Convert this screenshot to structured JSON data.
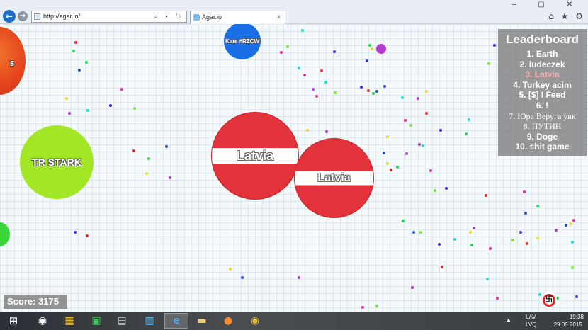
{
  "browser": {
    "back_icon": "back-arrow-icon",
    "forward_icon": "forward-arrow-icon",
    "url": "http://agar.io/",
    "address_tools": "⌕ ▾ ↻",
    "tab_title": "Agar.io",
    "tab_close": "×",
    "window_controls": "– ▢ ✕",
    "toolbar_icons": "⌂ ★ ⚙"
  },
  "game": {
    "cells": [
      {
        "name": "Latvia"
      },
      {
        "name": "Latvia"
      },
      {
        "name": "TR STARK"
      },
      {
        "name": "Kate #RZCW"
      },
      {
        "name": "5"
      }
    ],
    "leaderboard": {
      "title": "Leaderboard",
      "entries": [
        "1. Earth",
        "2. ludeczek",
        "3. Latvia",
        "4. Turkey acim",
        "5. [$] I Feed",
        "6. !",
        "7. Юра Веруга увк",
        "8. ПУТИН",
        "9. Doge",
        "10. shit game"
      ],
      "highlight_index": 2,
      "highlight_color": "#ffaaaa"
    },
    "score": "Score: 3175",
    "colors": {
      "latvia_red": "#e2323c",
      "stark_green": "#a3e625",
      "kate_blue": "#1a6fe6",
      "planet_orange": "#e6451d"
    }
  },
  "taskbar": {
    "start_icon": "windows-logo-icon",
    "apps": [
      "chrome-icon",
      "store-icon",
      "excel-icon",
      "media-icon",
      "control-panel-icon",
      "internet-explorer-icon",
      "file-explorer-icon",
      "firefox-icon",
      "chrome-app-icon"
    ],
    "lang_top": "LAV",
    "lang_bottom": "LVQ",
    "time": "19:38",
    "date": "29.05.2015."
  }
}
